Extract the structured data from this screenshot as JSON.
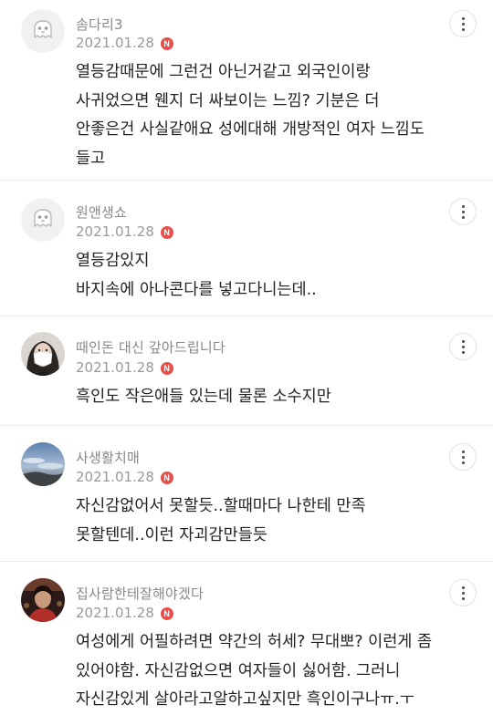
{
  "comments": [
    {
      "nickname": "솜다리3",
      "date": "2021.01.28",
      "badge": "N",
      "avatar": "default-ghost-avatar",
      "text": "열등감때문에 그런건 아닌거같고 외국인이랑\n사귀었으면 웬지 더 싸보이는 느낌? 기분은 더\n안좋은건 사실같애요 성에대해 개방적인 여자 느낌도\n들고"
    },
    {
      "nickname": "원앤생쇼",
      "date": "2021.01.28",
      "badge": "N",
      "avatar": "default-ghost-avatar",
      "text": "열등감있지\n바지속에 아나콘다를 넣고다니는데.."
    },
    {
      "nickname": "때인돈 대신 갚아드립니다",
      "date": "2021.01.28",
      "badge": "N",
      "avatar": "photo-masked-woman-avatar",
      "text": "흑인도 작은애들 있는데 물론 소수지만"
    },
    {
      "nickname": "사생활치매",
      "date": "2021.01.28",
      "badge": "N",
      "avatar": "photo-sky-avatar",
      "text": "자신감없어서 못할듯..할때마다 나한테 만족\n못할텐데..이런 자괴감만들듯"
    },
    {
      "nickname": "집사람한테잘해야겠다",
      "date": "2021.01.28",
      "badge": "N",
      "avatar": "photo-stage-avatar",
      "text": "여성에게 어필하려면 약간의 허세? 무대뽀? 이런게 좀\n있어야함. 자신감없으면 여자들이 싫어함. 그러니\n자신감있게 살아라고알하고싶지만 흑인이구나ㅠ.ㅜ"
    }
  ]
}
